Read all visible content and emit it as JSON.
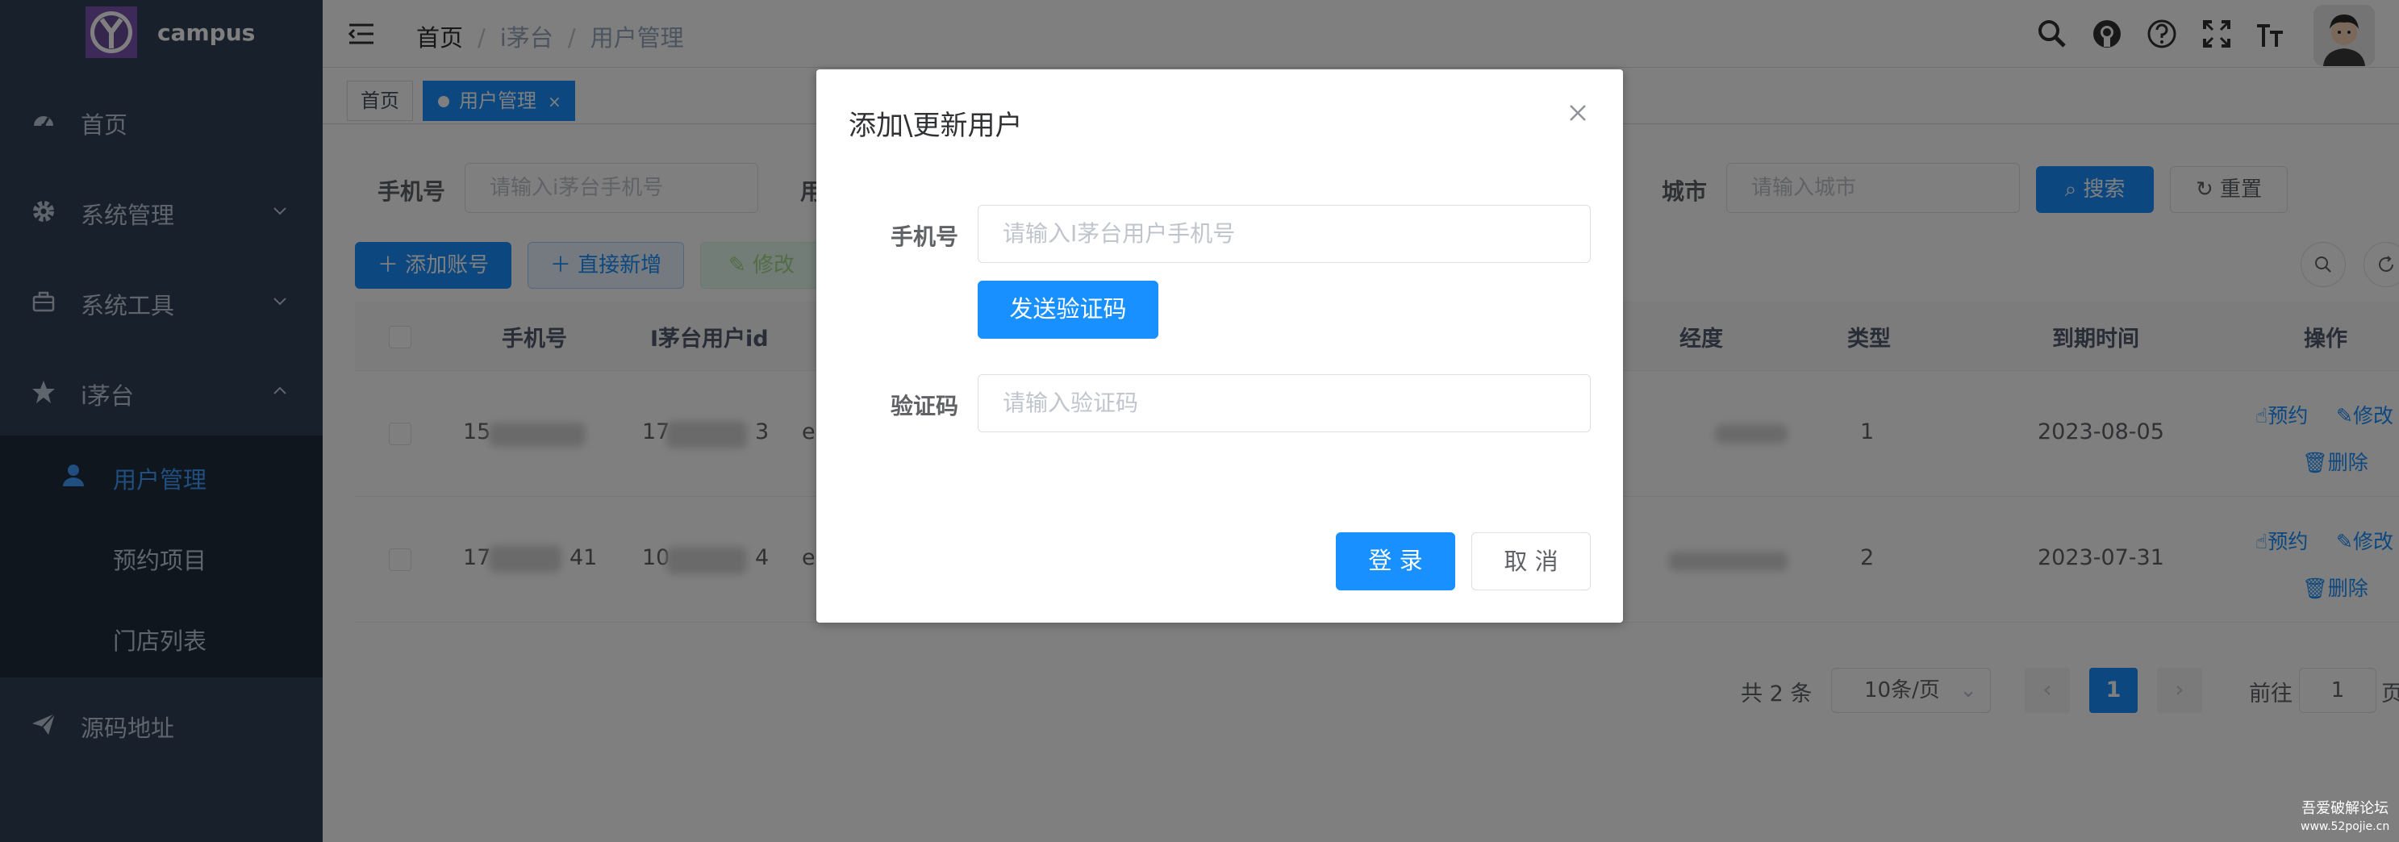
{
  "sidebar": {
    "brand": "campus",
    "menu": [
      {
        "label": "首页",
        "icon": "dashboard-icon"
      },
      {
        "label": "系统管理",
        "icon": "gear-icon"
      },
      {
        "label": "系统工具",
        "icon": "toolbox-icon"
      },
      {
        "label": "i茅台",
        "icon": "star-icon"
      }
    ],
    "submenu": [
      {
        "label": "用户管理",
        "icon": "user-icon",
        "active": true
      },
      {
        "label": "预约项目"
      },
      {
        "label": "门店列表"
      }
    ],
    "source_link": "源码地址"
  },
  "header": {
    "breadcrumb": [
      "首页",
      "i茅台",
      "用户管理"
    ],
    "separator": "/"
  },
  "tags": [
    {
      "label": "首页",
      "active": false
    },
    {
      "label": "用户管理",
      "active": true,
      "close": "×"
    }
  ],
  "search": {
    "phone_label": "手机号",
    "phone_placeholder": "请输入i茅台手机号",
    "user_label_partial": "用",
    "city_label": "城市",
    "city_placeholder": "请输入城市",
    "search_button": "搜索",
    "reset_button": "重置"
  },
  "toolbar": {
    "add_account": "添加账号",
    "direct_add": "直接新增",
    "edit": "修改"
  },
  "table": {
    "columns": [
      "手机号",
      "I茅台用户id",
      "经度",
      "类型",
      "到期时间",
      "操作"
    ],
    "rows": [
      {
        "phone_prefix": "15",
        "uid_prefix": "17",
        "uid_suffix": "3",
        "col_partial": "e",
        "type": "1",
        "expire": "2023-08-05"
      },
      {
        "phone_prefix": "17",
        "phone_suffix": "41",
        "uid_prefix": "10",
        "uid_suffix": "4",
        "col_partial": "e",
        "type": "2",
        "expire": "2023-07-31"
      }
    ],
    "actions": {
      "reserve": "预约",
      "edit": "修改",
      "delete": "删除"
    }
  },
  "pagination": {
    "total": "共 2 条",
    "page_size": "10条/页",
    "current_page": "1",
    "goto_label": "前往",
    "goto_value": "1",
    "page_suffix": "页"
  },
  "dialog": {
    "title": "添加\\更新用户",
    "phone_label": "手机号",
    "phone_placeholder": "请输入I茅台用户手机号",
    "send_code_button": "发送验证码",
    "code_label": "验证码",
    "code_placeholder": "请输入验证码",
    "login_button": "登 录",
    "cancel_button": "取 消"
  },
  "watermark": {
    "line1": "吾爱破解论坛",
    "line2": "www.52pojie.cn"
  },
  "colors": {
    "sidebar_bg": "#304156",
    "submenu_bg": "#1f2d3d",
    "primary": "#1890ff",
    "overlay": "rgba(0,0,0,0.5)"
  }
}
